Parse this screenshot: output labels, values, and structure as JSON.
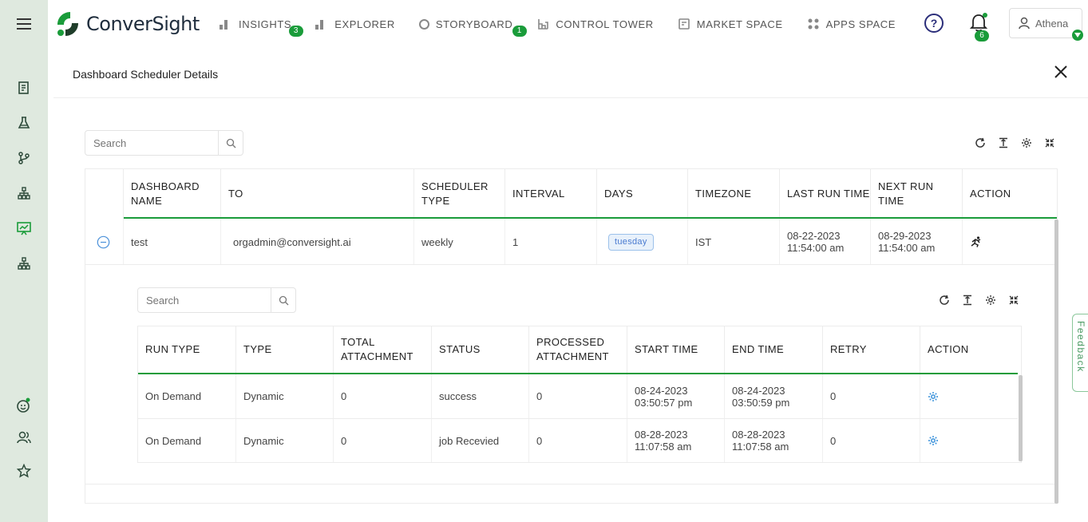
{
  "header": {
    "brand": "ConverSight",
    "nav": [
      {
        "label": "INSIGHTS",
        "badge": "3"
      },
      {
        "label": "EXPLORER"
      },
      {
        "label": "STORYBOARD",
        "badge": "1"
      },
      {
        "label": "CONTROL TOWER"
      },
      {
        "label": "MARKET SPACE"
      },
      {
        "label": "APPS SPACE"
      }
    ],
    "help_label": "?",
    "notification_count": "6",
    "user_name": "Athena"
  },
  "colors": {
    "accent": "#1a9c3a",
    "sidebar_bg": "#dfe9df",
    "link": "#2f8bd8"
  },
  "sidebar": {
    "icons": [
      "report-icon",
      "flask-icon",
      "branch-icon",
      "hierarchy-icon",
      "presentation-icon",
      "sitemap-icon",
      "bot-icon",
      "users-icon",
      "star-icon"
    ]
  },
  "panel": {
    "title": "Dashboard Scheduler Details"
  },
  "outer_search": {
    "placeholder": "Search"
  },
  "outer_table": {
    "columns": [
      "DASHBOARD NAME",
      "TO",
      "SCHEDULER TYPE",
      "INTERVAL",
      "DAYS",
      "TIMEZONE",
      "LAST RUN TIME",
      "NEXT RUN TIME",
      "ACTION"
    ],
    "row": {
      "name": "test",
      "to": "orgadmin@conversight.ai",
      "type": "weekly",
      "interval": "1",
      "days": "tuesday",
      "timezone": "IST",
      "last_date": "08-22-2023",
      "last_time": "11:54:00 am",
      "next_date": "08-29-2023",
      "next_time": "11:54:00 am"
    }
  },
  "inner_search": {
    "placeholder": "Search"
  },
  "inner_table": {
    "columns": [
      "RUN TYPE",
      "TYPE",
      "TOTAL ATTACHMENT",
      "STATUS",
      "PROCESSED ATTACHMENT",
      "START TIME",
      "END TIME",
      "RETRY",
      "ACTION"
    ],
    "rows": [
      {
        "run_type": "On Demand",
        "type": "Dynamic",
        "total": "0",
        "status": "success",
        "processed": "0",
        "start_date": "08-24-2023",
        "start_time": "03:50:57 pm",
        "end_date": "08-24-2023",
        "end_time": "03:50:59 pm",
        "retry": "0"
      },
      {
        "run_type": "On Demand",
        "type": "Dynamic",
        "total": "0",
        "status": "job Recevied",
        "processed": "0",
        "start_date": "08-28-2023",
        "start_time": "11:07:58 am",
        "end_date": "08-28-2023",
        "end_time": "11:07:58 am",
        "retry": "0"
      }
    ]
  },
  "feedback_label": "Feedback"
}
